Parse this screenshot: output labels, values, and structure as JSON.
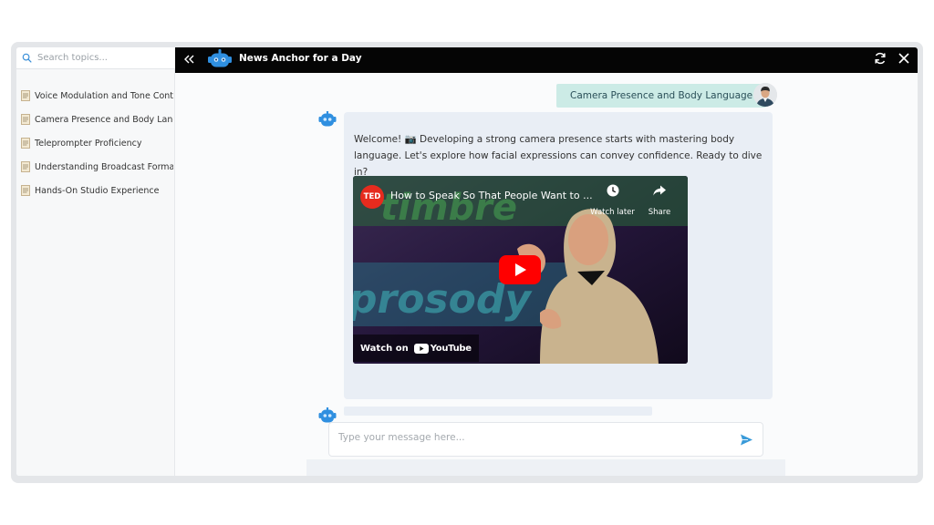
{
  "sidebar": {
    "search_placeholder": "Search topics...",
    "topics": [
      {
        "label": "Voice Modulation and Tone Cont...",
        "icon": "document-icon"
      },
      {
        "label": "Camera Presence and Body Lang...",
        "icon": "document-icon"
      },
      {
        "label": "Teleprompter Proficiency",
        "icon": "document-icon"
      },
      {
        "label": "Understanding Broadcast Formats",
        "icon": "document-icon"
      },
      {
        "label": "Hands-On Studio Experience",
        "icon": "document-icon"
      }
    ]
  },
  "header": {
    "title": "News Anchor for a Day"
  },
  "chat": {
    "user_message": "Camera Presence and Body Language",
    "bot_message": "Welcome! 📷 Developing a strong camera presence starts with mastering body language. Let's explore how facial expressions can convey confidence. Ready to dive in?",
    "video": {
      "channel_badge": "TED",
      "title": "How to Speak So That People Want to ...",
      "watch_later_label": "Watch later",
      "share_label": "Share",
      "watch_on_label": "Watch on",
      "youtube_label": "YouTube"
    },
    "composer_placeholder": "Type your message here..."
  },
  "colors": {
    "header_bg": "#050505",
    "user_bubble": "#ccebe6",
    "bot_bubble": "#e9eef5",
    "send_accent": "#3a9bd9",
    "bot_accent": "#2f8fe0"
  }
}
